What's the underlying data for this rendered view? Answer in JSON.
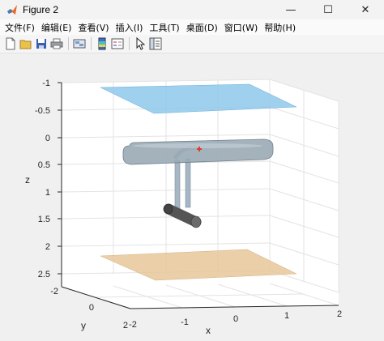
{
  "window": {
    "title": "Figure 2",
    "controls": {
      "minimize": "—",
      "maximize": "☐",
      "close": "✕"
    }
  },
  "menu": [
    "文件(F)",
    "编辑(E)",
    "查看(V)",
    "插入(I)",
    "工具(T)",
    "桌面(D)",
    "窗口(W)",
    "帮助(H)"
  ],
  "toolbar": [
    {
      "name": "new-figure-icon"
    },
    {
      "name": "open-file-icon"
    },
    {
      "name": "save-icon"
    },
    {
      "name": "print-icon"
    },
    {
      "name": "sep"
    },
    {
      "name": "link-plot-icon"
    },
    {
      "name": "sep"
    },
    {
      "name": "colorbar-icon"
    },
    {
      "name": "legend-icon"
    },
    {
      "name": "sep"
    },
    {
      "name": "pointer-icon"
    },
    {
      "name": "property-inspector-icon"
    }
  ],
  "axes": {
    "z_ticks": [
      "-1",
      "-0.5",
      "0",
      "0.5",
      "1",
      "1.5",
      "2",
      "2.5"
    ],
    "y_ticks": [
      "-2",
      "0",
      "2"
    ],
    "x_ticks": [
      "-2",
      "-1",
      "0",
      "1",
      "2"
    ],
    "xlabel": "x",
    "ylabel": "y",
    "zlabel": "z",
    "grid": true,
    "z_direction": "reversed"
  },
  "scene": {
    "top_plane_color": "#8ec8ea",
    "bottom_plane_color": "#e6c79a",
    "hull_color": "#9aaab4",
    "cylinder_color": "#555555",
    "marker_color": "#e03a2a"
  }
}
